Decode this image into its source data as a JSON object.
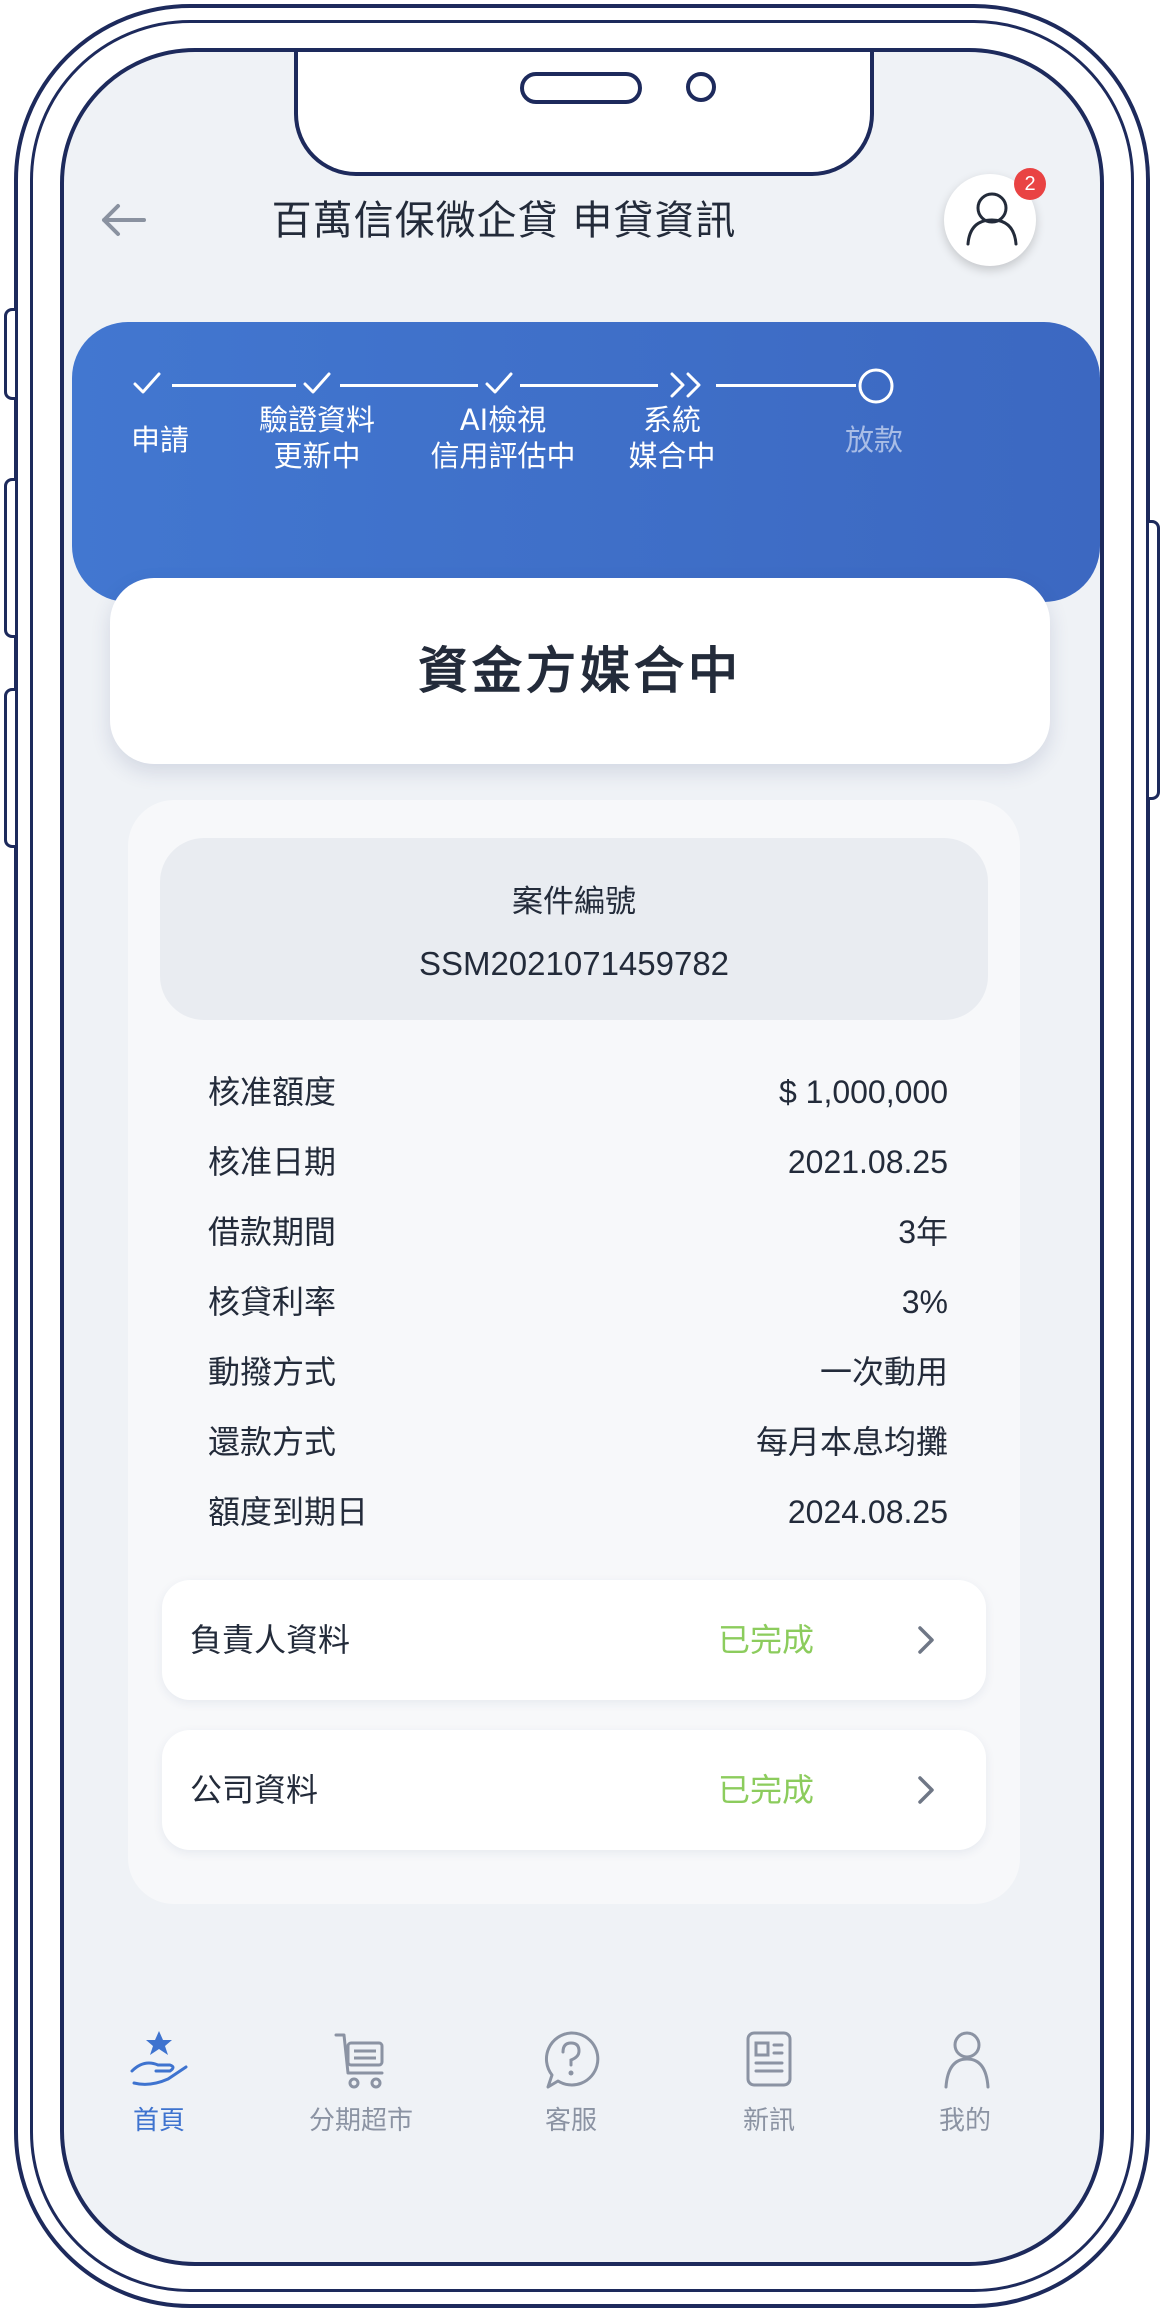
{
  "header": {
    "title": "百萬信保微企貸 申貸資訊",
    "notification_count": "2"
  },
  "stepper": {
    "steps": [
      {
        "line1": "申請",
        "line2": "",
        "state": "done"
      },
      {
        "line1": "驗證資料",
        "line2": "更新中",
        "state": "done"
      },
      {
        "line1": "AI檢視",
        "line2": "信用評估中",
        "state": "done"
      },
      {
        "line1": "系統",
        "line2": "媒合中",
        "state": "current"
      },
      {
        "line1": "放款",
        "line2": "",
        "state": "pending"
      }
    ]
  },
  "status": {
    "title": "資金方媒合中"
  },
  "case": {
    "label": "案件編號",
    "number": "SSM2021071459782"
  },
  "details": [
    {
      "label": "核准額度",
      "value": "$ 1,000,000"
    },
    {
      "label": "核准日期",
      "value": "2021.08.25"
    },
    {
      "label": "借款期間",
      "value": "3年"
    },
    {
      "label": "核貸利率",
      "value": "3%"
    },
    {
      "label": "動撥方式",
      "value": "一次動用"
    },
    {
      "label": "還款方式",
      "value": "每月本息均攤"
    },
    {
      "label": "額度到期日",
      "value": "2024.08.25"
    }
  ],
  "links": [
    {
      "label": "負責人資料",
      "status": "已完成"
    },
    {
      "label": "公司資料",
      "status": "已完成"
    }
  ],
  "tabbar": {
    "tabs": [
      {
        "label": "首頁",
        "icon": "home-hand-star-icon",
        "active": true
      },
      {
        "label": "分期超市",
        "icon": "shopping-cart-icon",
        "active": false
      },
      {
        "label": "客服",
        "icon": "help-bubble-icon",
        "active": false
      },
      {
        "label": "新訊",
        "icon": "news-icon",
        "active": false
      },
      {
        "label": "我的",
        "icon": "user-icon",
        "active": false
      }
    ]
  },
  "colors": {
    "accent_blue": "#3e73cf",
    "done_green": "#8ccc5d",
    "badge_red": "#e94343",
    "frame_navy": "#1d2a5c"
  }
}
